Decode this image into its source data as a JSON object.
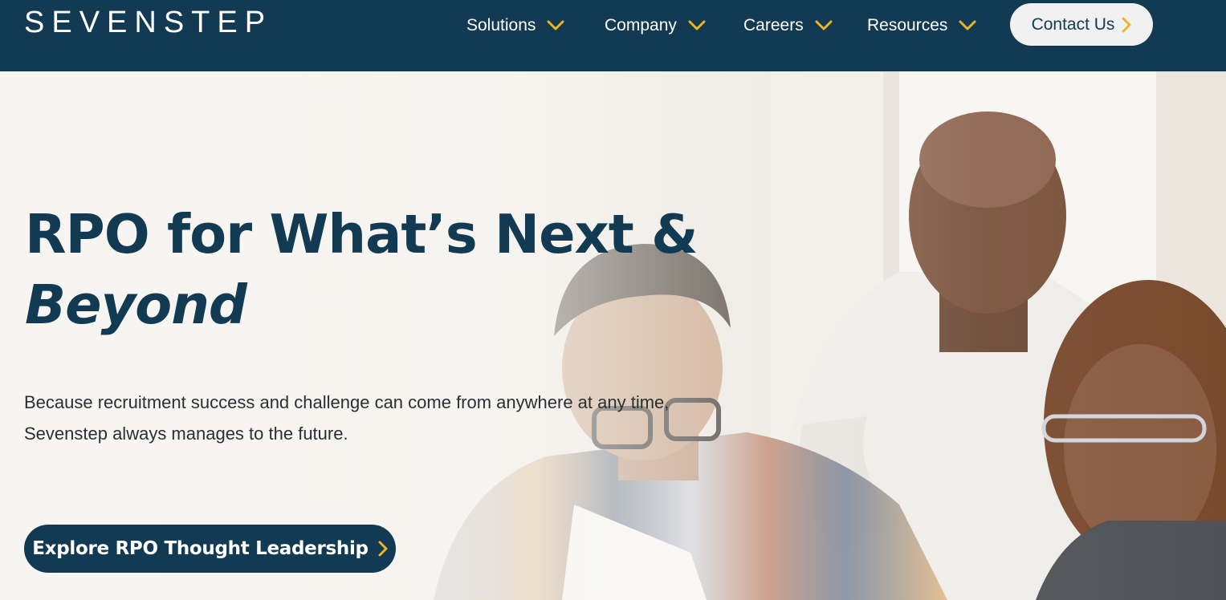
{
  "header": {
    "logo_text": "SEVENSTEP",
    "nav": [
      {
        "label": "Solutions"
      },
      {
        "label": "Company"
      },
      {
        "label": "Careers"
      },
      {
        "label": "Resources"
      }
    ],
    "contact_label": "Contact Us"
  },
  "hero": {
    "headline_line1": "RPO for What’s Next &",
    "headline_line2": "Beyond",
    "subtext_line1": "Because recruitment success and challenge can come from anywhere at any time,",
    "subtext_line2": "Sevenstep always manages to the future.",
    "cta_label": "Explore RPO Thought Leadership"
  },
  "icons": {
    "nav_chevron": "chevron-down-icon",
    "button_arrow": "chevron-right-icon"
  },
  "colors": {
    "brand_navy": "#123b53",
    "accent_gold": "#f0b323",
    "button_light": "#f1f1f1"
  }
}
